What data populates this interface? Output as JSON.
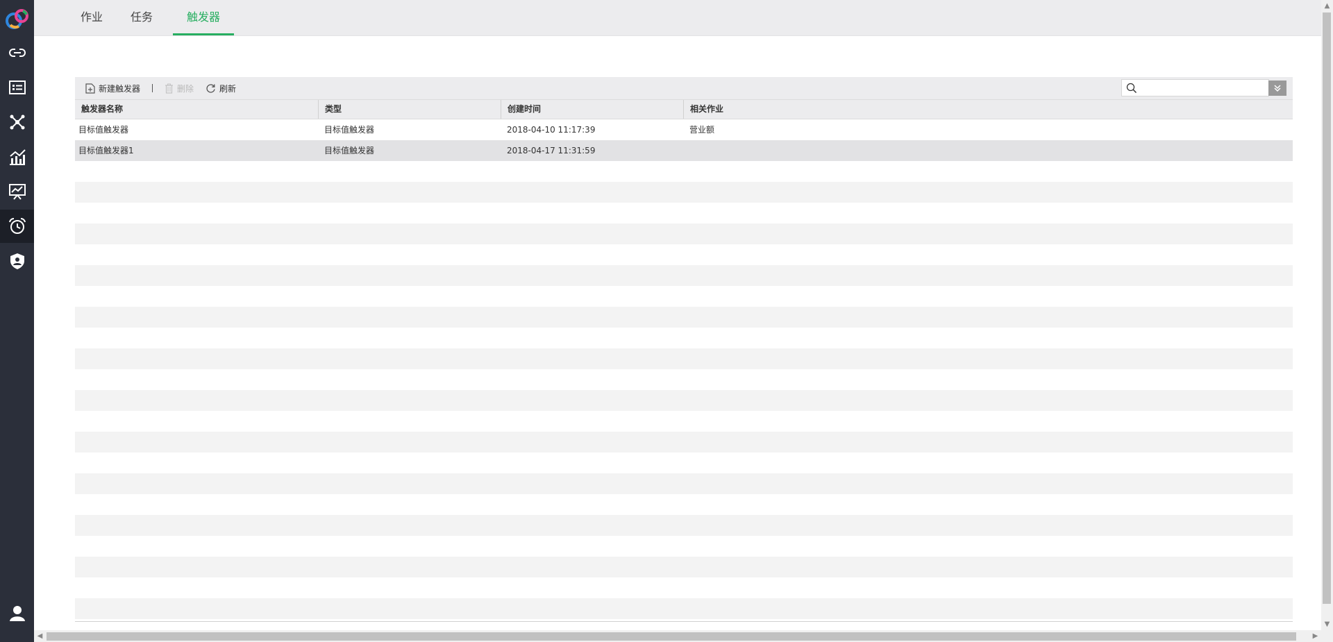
{
  "sidebar": {
    "items": [
      {
        "name": "logo-icon"
      },
      {
        "name": "link-icon"
      },
      {
        "name": "list-card-icon"
      },
      {
        "name": "network-icon"
      },
      {
        "name": "chart-icon"
      },
      {
        "name": "presentation-icon"
      },
      {
        "name": "alarm-clock-icon",
        "active": true
      },
      {
        "name": "shield-user-icon"
      },
      {
        "name": "user-icon"
      }
    ]
  },
  "tabs": [
    {
      "label": "作业"
    },
    {
      "label": "任务"
    },
    {
      "label": "触发器",
      "active": true
    }
  ],
  "toolbar": {
    "new_label": "新建触发器",
    "delete_label": "删除",
    "refresh_label": "刷新",
    "search_value": "",
    "search_placeholder": ""
  },
  "table": {
    "columns": [
      "触发器名称",
      "类型",
      "创建时间",
      "相关作业"
    ],
    "rows": [
      {
        "name": "目标值触发器",
        "type": "目标值触发器",
        "created": "2018-04-10 11:17:39",
        "job": "营业额"
      },
      {
        "name": "目标值触发器1",
        "type": "目标值触发器",
        "created": "2018-04-17 11:31:59",
        "job": "",
        "selected": true
      }
    ]
  },
  "colors": {
    "accent": "#27ae60",
    "sidebar_bg": "#2b2f3a",
    "sidebar_active": "#1c1f27"
  }
}
